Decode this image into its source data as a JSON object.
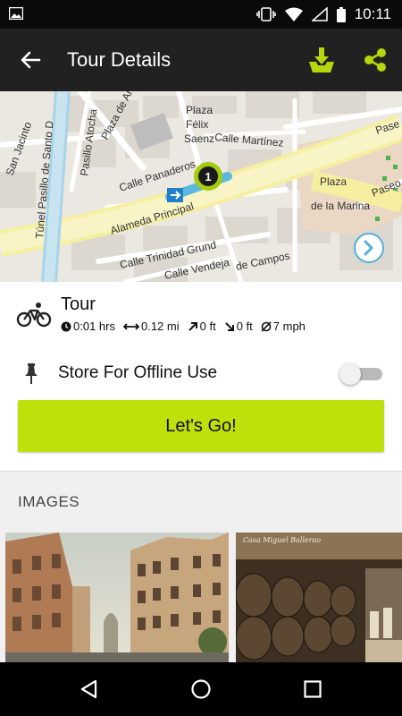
{
  "status_bar": {
    "time": "10:11",
    "icons": [
      "image-icon",
      "vibrate-icon",
      "wifi-icon",
      "no-signal-icon",
      "battery-icon"
    ]
  },
  "app_bar": {
    "title": "Tour Details",
    "icons": [
      "back-arrow-icon",
      "download-icon",
      "share-icon"
    ],
    "accent_color": "#b5d70c"
  },
  "map": {
    "labels": {
      "plaza_felix_1": "Plaza",
      "plaza_felix_2": "Félix",
      "plaza_felix_3": "Saenz",
      "calle_martinez": "Calle Martínez",
      "calle_panaderos": "Calle Panaderos",
      "alameda": "Alameda Principal",
      "calle_trinidad": "Calle Trinidad Grund",
      "calle_vendeja": "Calle Vendeja",
      "campos": "de Campos",
      "plaza_marina_1": "Plaza",
      "plaza_marina_2": "de la Marina",
      "tunel": "Túnel Pasillo de Santo D",
      "san_jacinto": "San Jacinto",
      "pasillo_atocha": "Pasillo Atocha",
      "plaza_arriola": "Plaza de Arriola",
      "paseo_1": "Pase",
      "paseo_2": "Paseo"
    },
    "marker_number": "1",
    "route_color": "#5bb9e0"
  },
  "tour": {
    "name": "Tour",
    "stats": {
      "duration": "0:01 hrs",
      "distance": "0.12 mi",
      "ascent": "0 ft",
      "descent": "0 ft",
      "avg_speed": "7 mph"
    }
  },
  "offline": {
    "label": "Store For Offline Use",
    "toggle_on": false
  },
  "go_button": {
    "label": "Let's Go!",
    "color": "#bfe00a"
  },
  "images": {
    "heading": "IMAGES",
    "thumb2_caption": "Casa Miguel Ballerao"
  },
  "nav_bar": {
    "icons": [
      "back-triangle-icon",
      "home-circle-icon",
      "recents-square-icon"
    ]
  }
}
